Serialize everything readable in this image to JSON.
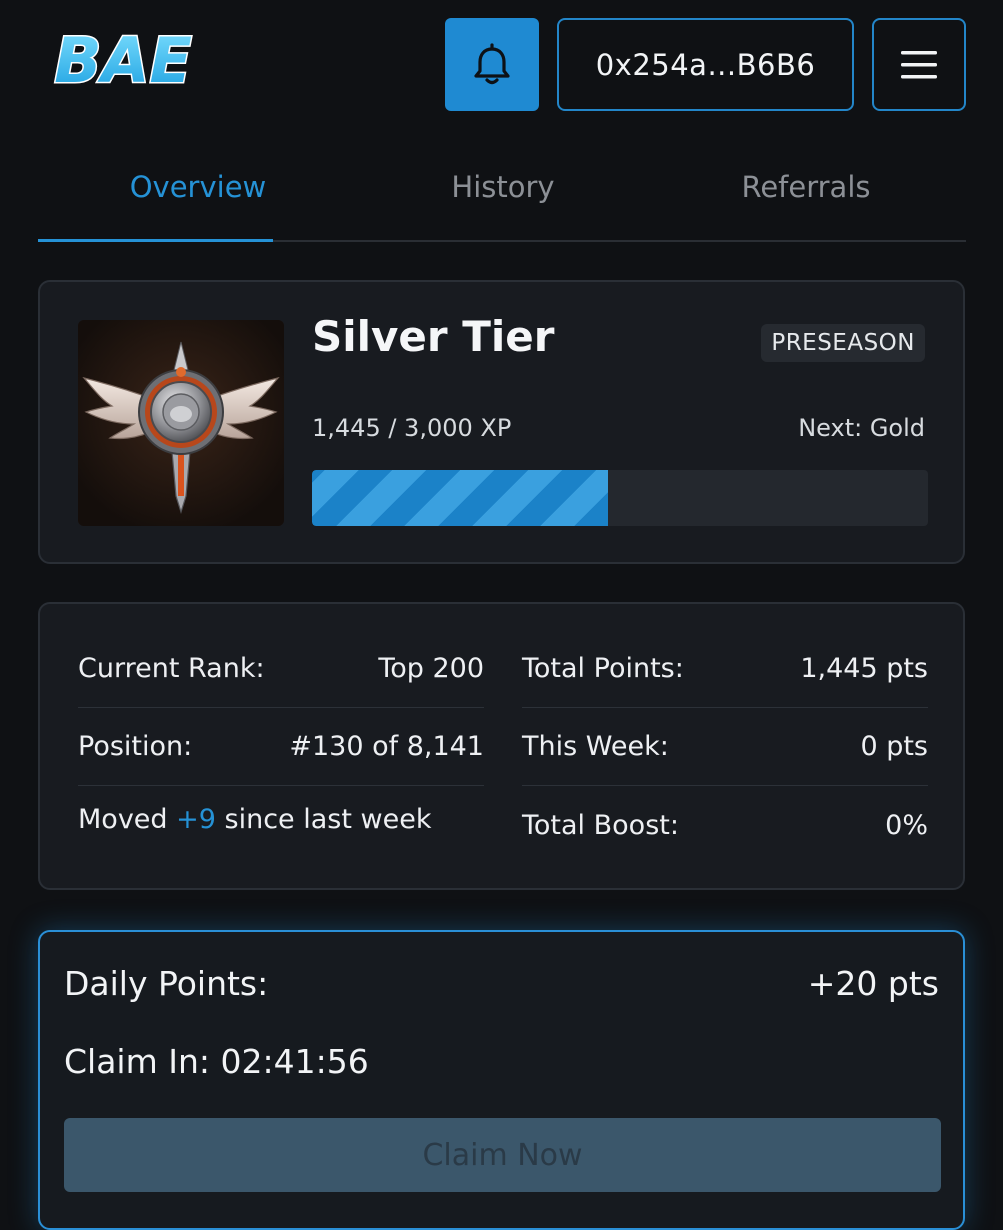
{
  "header": {
    "logo_text": "BAE",
    "bell_icon": "bell-icon",
    "wallet_address": "0x254a...B6B6",
    "menu_icon": "hamburger-menu-icon"
  },
  "tabs": [
    {
      "label": "Overview",
      "active": true
    },
    {
      "label": "History",
      "active": false
    },
    {
      "label": "Referrals",
      "active": false
    }
  ],
  "tier": {
    "badge_icon": "silver-winged-badge-icon",
    "title": "Silver Tier",
    "season_tag": "PRESEASON",
    "xp_text": "1,445 / 3,000 XP",
    "next_text": "Next: Gold",
    "progress_fraction": 0.48
  },
  "stats": {
    "current_rank_label": "Current Rank:",
    "current_rank_value": "Top 200",
    "position_label": "Position:",
    "position_value": "#130 of 8,141",
    "moved_prefix": "Moved ",
    "moved_value": "+9",
    "moved_suffix": " since last week",
    "total_points_label": "Total Points:",
    "total_points_value": "1,445 pts",
    "this_week_label": "This Week:",
    "this_week_value": "0 pts",
    "total_boost_label": "Total Boost:",
    "total_boost_value": "0%"
  },
  "daily": {
    "label": "Daily Points:",
    "value": "+20 pts",
    "claim_in_label": "Claim In: ",
    "claim_in_time": "02:41:56",
    "claim_button": "Claim Now"
  },
  "colors": {
    "accent": "#2592d6",
    "background": "#0f1114",
    "card": "#181b20"
  }
}
